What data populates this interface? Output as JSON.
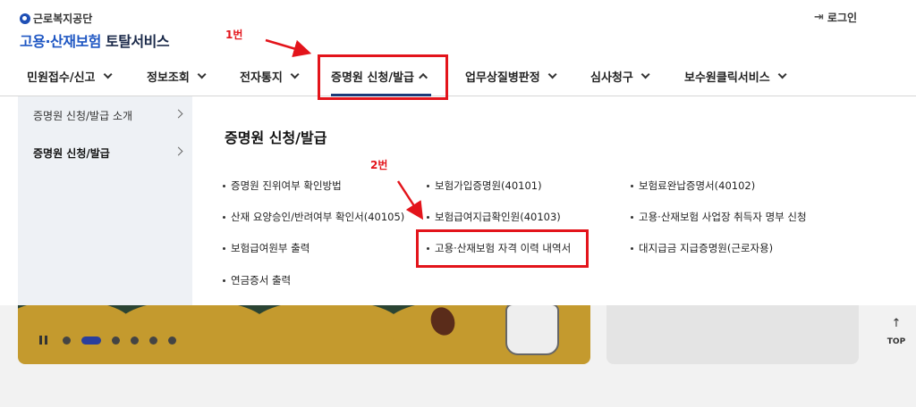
{
  "header": {
    "org_name": "근로복지공단",
    "title_blue": "고용·산재보험",
    "title_dark": "토탈서비스",
    "login_label": "로그인",
    "login_icon": "login-icon"
  },
  "nav": {
    "items": [
      {
        "label": "민원접수/신고"
      },
      {
        "label": "정보조회"
      },
      {
        "label": "전자통지"
      },
      {
        "label": "증명원 신청/발급"
      },
      {
        "label": "업무상질병판정"
      },
      {
        "label": "심사청구"
      },
      {
        "label": "보수원클릭서비스"
      }
    ],
    "active_index": 3,
    "active_color": "#1b3a78"
  },
  "dropdown": {
    "title": "증명원 신청/발급",
    "submenu": [
      {
        "label": "증명원 신청/발급 소개"
      },
      {
        "label": "증명원 신청/발급"
      }
    ],
    "links": [
      "증명원 진위여부 확인방법",
      "보험가입증명원(40101)",
      "보험료완납증명서(40102)",
      "산재 요양승인/반려여부 확인서(40105)",
      "보험급여지급확인원(40103)",
      "고용·산재보험 사업장 취득자 명부 신청",
      "보험급여원부 출력",
      "고용·산재보험 자격 이력 내역서",
      "대지급금 지급증명원(근로자용)",
      "연금증서 출력"
    ]
  },
  "annotations": {
    "step1": "1번",
    "step2": "2번",
    "color": "#e3141b"
  },
  "top_button": {
    "label": "TOP"
  }
}
